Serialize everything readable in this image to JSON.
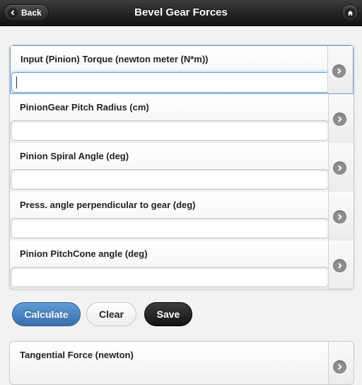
{
  "header": {
    "title": "Bevel Gear Forces",
    "back_label": "Back",
    "back_icon": "chevron-left-icon",
    "home_icon": "home-icon"
  },
  "fields": [
    {
      "label": "Input (Pinion) Torque (newton meter (N*m))",
      "value": ""
    },
    {
      "label": "PinionGear Pitch Radius (cm)",
      "value": ""
    },
    {
      "label": "Pinion Spiral Angle (deg)",
      "value": ""
    },
    {
      "label": "Press. angle perpendicular to gear (deg)",
      "value": ""
    },
    {
      "label": "Pinion PitchCone angle (deg)",
      "value": ""
    }
  ],
  "buttons": {
    "calculate": "Calculate",
    "clear": "Clear",
    "save": "Save"
  },
  "outputs": [
    {
      "label": "Tangential Force (newton)"
    }
  ],
  "colors": {
    "accent": "#396fac",
    "header": "#1a1a1a",
    "focus": "#6d9fd5"
  }
}
